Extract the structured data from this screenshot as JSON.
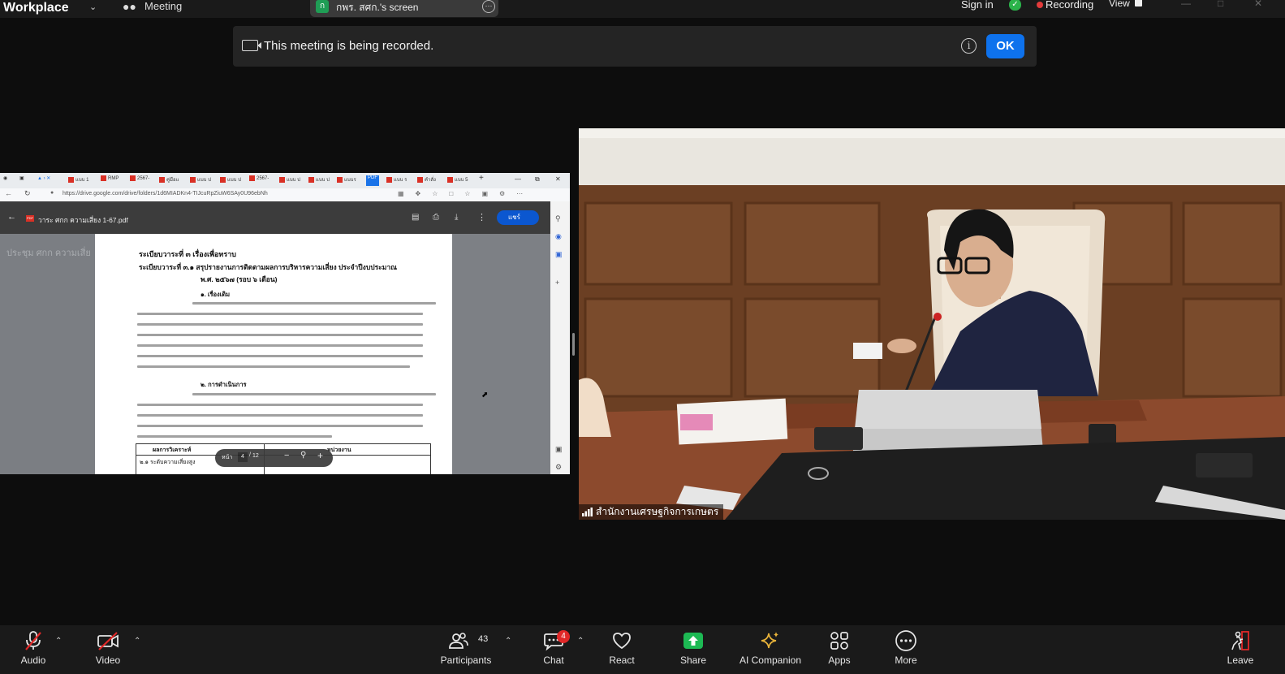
{
  "topbar": {
    "app_title": "Workplace",
    "meeting_label": "Meeting",
    "shared_screen_label": "กพร. สศก.'s screen",
    "shared_screen_initial": "ก",
    "sign_in": "Sign in",
    "recording_label": "Recording",
    "view_label": "View",
    "icons": [
      "people-icon",
      "chevron-down-icon",
      "more-icon",
      "shield-check-icon",
      "record-dot-icon"
    ],
    "colors": {
      "recording": "#e23b3b",
      "shield": "#2bb34a"
    }
  },
  "banner": {
    "text": "This meeting is being recorded.",
    "ok_label": "OK",
    "icons": [
      "camera-icon",
      "info-icon"
    ],
    "ok_color": "#0e72ed"
  },
  "shared_screen": {
    "browser": {
      "url": "https://drive.google.com/drive/folders/1d6MIADKn4-TIJcuRpZiuW6SAy0U96ebNh",
      "tabs": [
        "แบบ 1",
        "RMP",
        "2567-",
        "คู่มือแ",
        "แบบ ป",
        "แบบ ป",
        "2567-",
        "แบบ ป",
        "แบบ ป",
        "แบบร",
        "PDF",
        "แบบ ร",
        "คำสั่ง",
        "แบบ 5"
      ]
    },
    "pdf": {
      "title": "วาระ ศกก ความเสี่ยง 1-67.pdf",
      "share_label": "แชร์",
      "drive_title": "ประชุม ศกก ความเสี่ย",
      "heading_1": "ระเบียบวาระที่ ๓   เรื่องเพื่อทราบ",
      "heading_2": "ระเบียบวาระที่ ๓.๑  สรุปรายงานการติดตามผลการบริหารความเสี่ยง ประจำปีงบประมาณ",
      "heading_3": "พ.ศ. ๒๕๖๗  (รอบ ๖ เดือน)",
      "section_1": "๑. เรื่องเดิม",
      "section_2": "๒. การดำเนินการ",
      "table_headers": [
        "ผลการวิเคราะห์",
        "หน่วยงาน"
      ],
      "table_first_cell": "๒.๑ ระดับความเสี่ยงสูง",
      "page_label": "หน้า",
      "page_current": "4",
      "page_total": "12"
    }
  },
  "video": {
    "participant_name": "สำนักงานเศรษฐกิจการเกษตร"
  },
  "toolbar": {
    "items": [
      {
        "label": "Audio",
        "icon": "mic-muted-icon"
      },
      {
        "label": "Video",
        "icon": "video-off-icon"
      },
      {
        "label": "Participants",
        "icon": "participants-icon"
      },
      {
        "label": "Chat",
        "icon": "chat-icon"
      },
      {
        "label": "React",
        "icon": "heart-icon"
      },
      {
        "label": "Share",
        "icon": "share-icon"
      },
      {
        "label": "AI Companion",
        "icon": "sparkle-icon"
      },
      {
        "label": "Apps",
        "icon": "apps-icon"
      },
      {
        "label": "More",
        "icon": "more-icon"
      },
      {
        "label": "Leave",
        "icon": "leave-icon"
      }
    ],
    "participants_count": "43",
    "chat_badge": "4",
    "colors": {
      "share": "#1db954",
      "leave": "#e02828",
      "ai": "#e8b33a"
    }
  }
}
